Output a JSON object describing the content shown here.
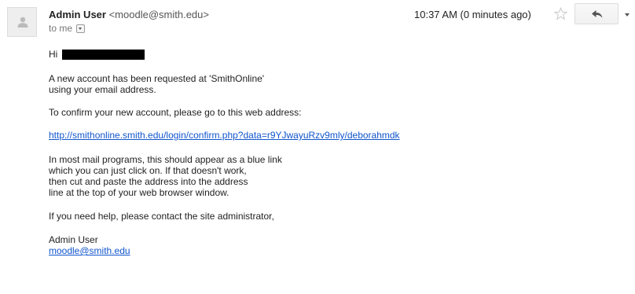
{
  "header": {
    "sender_name": "Admin User",
    "sender_email": "<moodle@smith.edu>",
    "to_label": "to me",
    "timestamp": "10:37 AM (0 minutes ago)"
  },
  "message": {
    "greeting": "Hi",
    "para1_line1": "A new account has been requested at 'SmithOnline'",
    "para1_line2": "using your email address.",
    "para2": "To confirm your new account, please go to this web address:",
    "confirm_link": "http://smithonline.smith.edu/login/confirm.php?data=r9YJwayuRzv9mly/deborahmdk",
    "para3_line1": "In most mail programs, this should appear as a blue link",
    "para3_line2": "which you can just click on. If that doesn't work,",
    "para3_line3": "then cut and paste the address into the address",
    "para3_line4": "line at the top of your web browser window.",
    "para4": "If you need help, please contact the site administrator,",
    "signature_name": "Admin User",
    "signature_email": "moodle@smith.edu"
  },
  "icons": {
    "avatar": "person-silhouette-icon",
    "star": "star-outline-icon",
    "reply": "reply-arrow-icon",
    "more": "chevron-down-icon"
  },
  "colors": {
    "link": "#1155cc",
    "text": "#222222",
    "muted": "#777777"
  }
}
